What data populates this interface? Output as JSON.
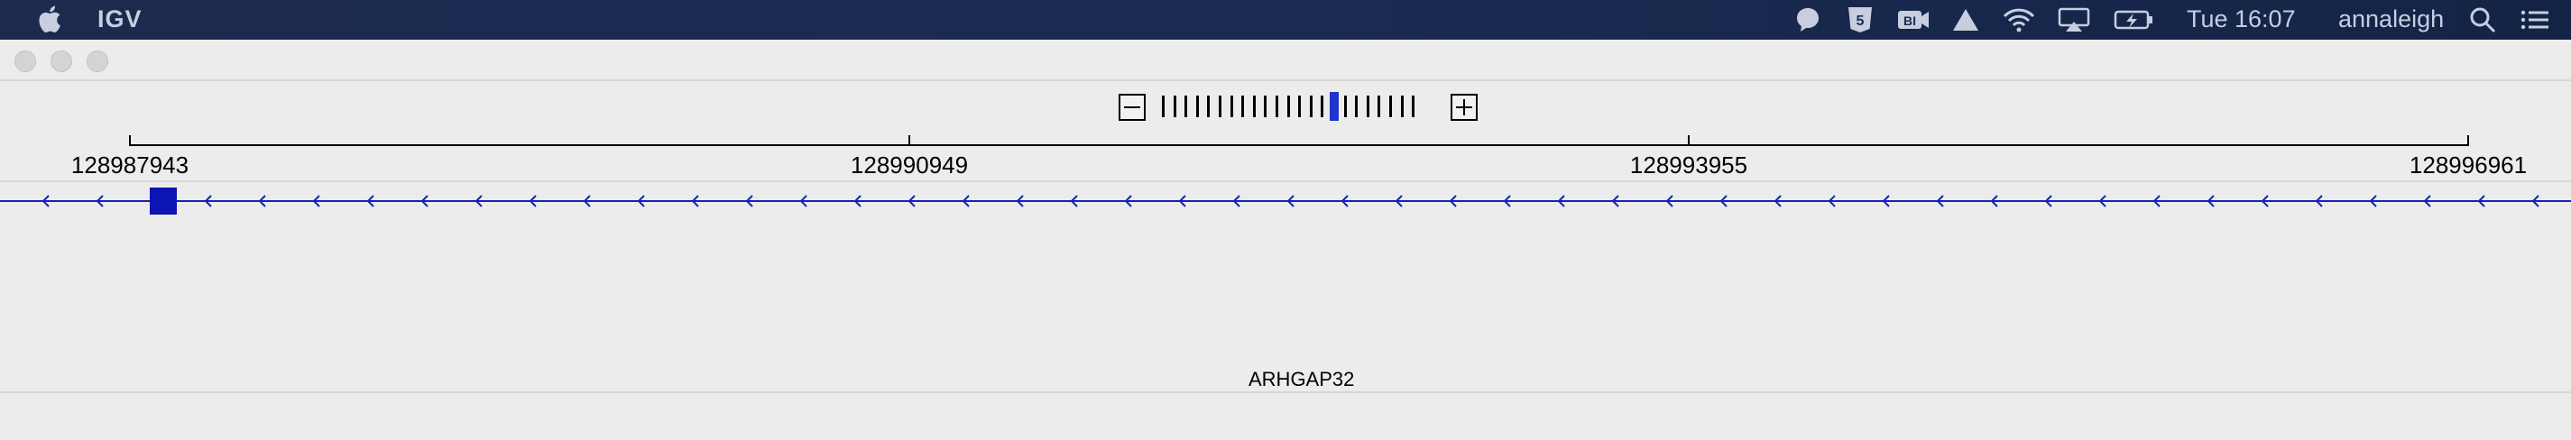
{
  "menubar": {
    "app_name": "IGV",
    "clock": "Tue 16:07",
    "user": "annaleigh",
    "icons": [
      "apple-icon",
      "chat-bubble-icon",
      "html5-shield-icon",
      "bi-camera-icon",
      "drive-triangle-icon",
      "wifi-icon",
      "airplay-icon",
      "battery-charging-icon",
      "search-icon",
      "menu-list-icon"
    ]
  },
  "window": {
    "buttons": [
      "close",
      "minimize",
      "zoom"
    ]
  },
  "zoom": {
    "minus_icon": "minus-icon",
    "plus_icon": "plus-icon",
    "tick_count": 23,
    "active_index": 15
  },
  "ruler": {
    "labels": [
      "128987943",
      "128990949",
      "128993955",
      "128996961"
    ]
  },
  "track": {
    "gene_name": "ARHGAP32",
    "strand": "minus",
    "color": "#1522b8"
  }
}
